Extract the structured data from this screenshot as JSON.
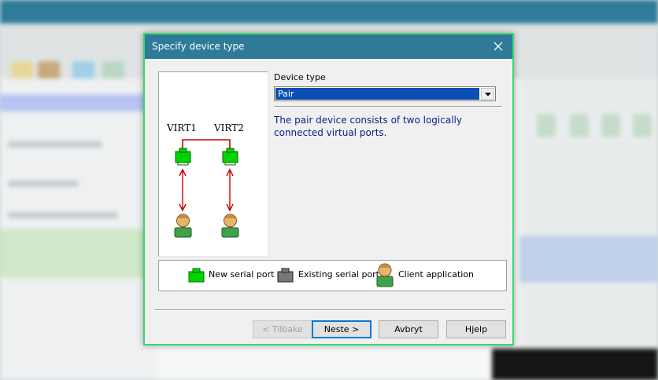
{
  "dialog": {
    "title": "Specify device type",
    "device_type_label": "Device type",
    "device_type_value": "Pair",
    "description": "The pair device consists of two logically connected virtual ports.",
    "diagram": {
      "port_labels": [
        "VIRT1",
        "VIRT2"
      ],
      "colors": {
        "connection_line": "#cc0000",
        "new_port": "#00cc00"
      }
    },
    "legend": {
      "new_port": "New serial port",
      "existing_port": "Existing serial port",
      "client_app": "Client application"
    },
    "buttons": {
      "back": "< Tilbake",
      "next": "Neste >",
      "cancel": "Avbryt",
      "help": "Hjelp"
    }
  },
  "colors": {
    "title_bar": "#2e7a98",
    "dialog_border": "#35d96e",
    "description_text": "#0a1c8a",
    "selection": "#0a4fb6"
  }
}
